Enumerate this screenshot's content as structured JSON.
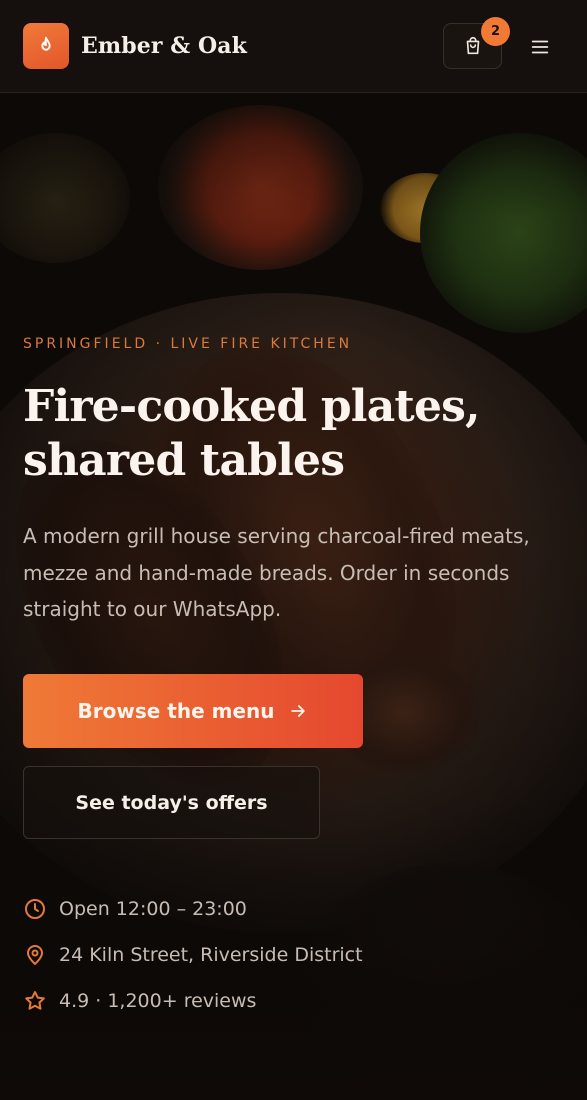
{
  "header": {
    "brand": "Ember & Oak",
    "logo_icon": "flame-icon",
    "cart_icon": "shopping-bag-icon",
    "cart_count": "2",
    "menu_icon": "hamburger-menu-icon"
  },
  "hero": {
    "eyebrow": "SPRINGFIELD · LIVE FIRE KITCHEN",
    "headline": "Fire-cooked plates, shared tables",
    "description": "A modern grill house serving charcoal-fired meats, mezze and hand-made breads. Order in seconds straight to our WhatsApp.",
    "primary_cta": "Browse the menu",
    "primary_cta_icon": "arrow-right-icon",
    "secondary_cta": "See today's offers"
  },
  "info": [
    {
      "icon": "clock-icon",
      "text": "Open 12:00 – 23:00"
    },
    {
      "icon": "map-pin-icon",
      "text": "24 Kiln Street, Riverside District"
    },
    {
      "icon": "star-icon",
      "text": "4.9 · 1,200+ reviews"
    }
  ],
  "colors": {
    "accent": "#ef7a36",
    "accent_end": "#e5482f",
    "background": "#120c09",
    "eyebrow": "#d97a3c"
  }
}
